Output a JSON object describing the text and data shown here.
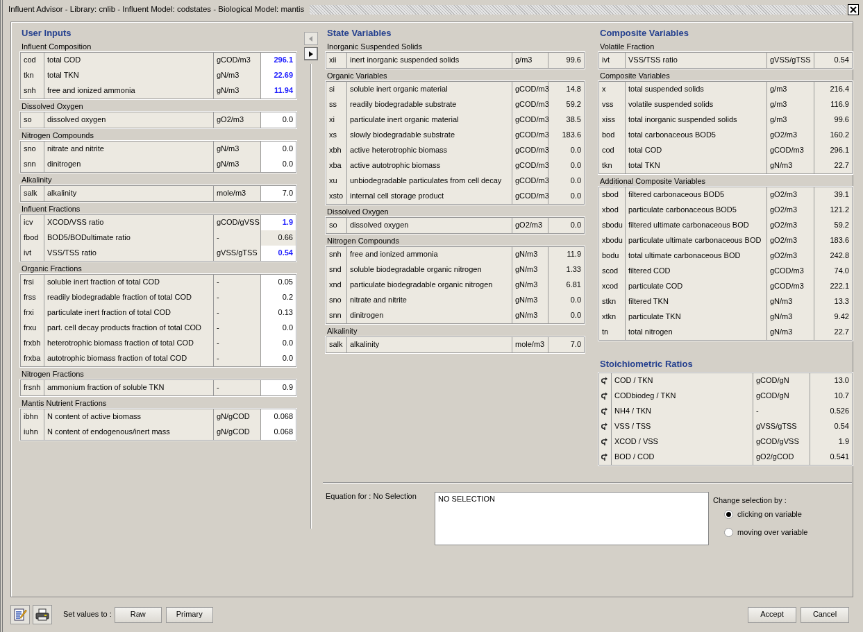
{
  "window": {
    "title": "Influent Advisor - Library: cnlib - Influent Model: codstates - Biological Model: mantis"
  },
  "user_inputs": {
    "title": "User Inputs",
    "groups": [
      {
        "label": "Influent Composition",
        "rows": [
          {
            "symbol": "cod",
            "description": "total COD",
            "unit": "gCOD/m3",
            "value": "296.1",
            "editable": true,
            "modified": true
          },
          {
            "symbol": "tkn",
            "description": "total TKN",
            "unit": "gN/m3",
            "value": "22.69",
            "editable": true,
            "modified": true
          },
          {
            "symbol": "snh",
            "description": "free and ionized ammonia",
            "unit": "gN/m3",
            "value": "11.94",
            "editable": true,
            "modified": true
          }
        ]
      },
      {
        "label": "Dissolved Oxygen",
        "rows": [
          {
            "symbol": "so",
            "description": "dissolved oxygen",
            "unit": "gO2/m3",
            "value": "0.0",
            "editable": true,
            "modified": false
          }
        ]
      },
      {
        "label": "Nitrogen Compounds",
        "rows": [
          {
            "symbol": "sno",
            "description": "nitrate and nitrite",
            "unit": "gN/m3",
            "value": "0.0",
            "editable": true,
            "modified": false
          },
          {
            "symbol": "snn",
            "description": "dinitrogen",
            "unit": "gN/m3",
            "value": "0.0",
            "editable": true,
            "modified": false
          }
        ]
      },
      {
        "label": "Alkalinity",
        "rows": [
          {
            "symbol": "salk",
            "description": "alkalinity",
            "unit": "mole/m3",
            "value": "7.0",
            "editable": true,
            "modified": false
          }
        ]
      },
      {
        "label": "Influent Fractions",
        "rows": [
          {
            "symbol": "icv",
            "description": "XCOD/VSS ratio",
            "unit": "gCOD/gVSS",
            "value": "1.9",
            "editable": true,
            "modified": true
          },
          {
            "symbol": "fbod",
            "description": "BOD5/BODultimate ratio",
            "unit": "-",
            "value": "0.66",
            "editable": false,
            "modified": false
          },
          {
            "symbol": "ivt",
            "description": "VSS/TSS ratio",
            "unit": "gVSS/gTSS",
            "value": "0.54",
            "editable": true,
            "modified": true
          }
        ]
      },
      {
        "label": "Organic Fractions",
        "rows": [
          {
            "symbol": "frsi",
            "description": "soluble inert fraction of total COD",
            "unit": "-",
            "value": "0.05",
            "editable": true,
            "modified": false
          },
          {
            "symbol": "frss",
            "description": "readily biodegradable fraction of total COD",
            "unit": "-",
            "value": "0.2",
            "editable": true,
            "modified": false
          },
          {
            "symbol": "frxi",
            "description": "particulate inert fraction of total COD",
            "unit": "-",
            "value": "0.13",
            "editable": true,
            "modified": false
          },
          {
            "symbol": "frxu",
            "description": "part. cell decay products fraction of total COD",
            "unit": "-",
            "value": "0.0",
            "editable": true,
            "modified": false
          },
          {
            "symbol": "frxbh",
            "description": "heterotrophic biomass fraction of total COD",
            "unit": "-",
            "value": "0.0",
            "editable": true,
            "modified": false
          },
          {
            "symbol": "frxba",
            "description": "autotrophic biomass fraction of total COD",
            "unit": "-",
            "value": "0.0",
            "editable": true,
            "modified": false
          }
        ]
      },
      {
        "label": "Nitrogen Fractions",
        "rows": [
          {
            "symbol": "frsnh",
            "description": "ammonium fraction of soluble TKN",
            "unit": "-",
            "value": "0.9",
            "editable": true,
            "modified": false
          }
        ]
      },
      {
        "label": "Mantis Nutrient Fractions",
        "rows": [
          {
            "symbol": "ibhn",
            "description": "N content of active biomass",
            "unit": "gN/gCOD",
            "value": "0.068",
            "editable": true,
            "modified": false
          },
          {
            "symbol": "iuhn",
            "description": "N content of endogenous/inert mass",
            "unit": "gN/gCOD",
            "value": "0.068",
            "editable": true,
            "modified": false
          }
        ]
      }
    ]
  },
  "state_variables": {
    "title": "State Variables",
    "groups": [
      {
        "label": "Inorganic Suspended Solids",
        "rows": [
          {
            "symbol": "xii",
            "description": "inert inorganic suspended solids",
            "unit": "g/m3",
            "value": "99.6"
          }
        ]
      },
      {
        "label": "Organic Variables",
        "rows": [
          {
            "symbol": "si",
            "description": "soluble inert organic material",
            "unit": "gCOD/m3",
            "value": "14.8"
          },
          {
            "symbol": "ss",
            "description": "readily biodegradable substrate",
            "unit": "gCOD/m3",
            "value": "59.2"
          },
          {
            "symbol": "xi",
            "description": "particulate inert organic material",
            "unit": "gCOD/m3",
            "value": "38.5"
          },
          {
            "symbol": "xs",
            "description": "slowly biodegradable substrate",
            "unit": "gCOD/m3",
            "value": "183.6"
          },
          {
            "symbol": "xbh",
            "description": "active heterotrophic biomass",
            "unit": "gCOD/m3",
            "value": "0.0"
          },
          {
            "symbol": "xba",
            "description": "active autotrophic biomass",
            "unit": "gCOD/m3",
            "value": "0.0"
          },
          {
            "symbol": "xu",
            "description": "unbiodegradable particulates from cell decay",
            "unit": "gCOD/m3",
            "value": "0.0"
          },
          {
            "symbol": "xsto",
            "description": "internal cell storage product",
            "unit": "gCOD/m3",
            "value": "0.0"
          }
        ]
      },
      {
        "label": "Dissolved Oxygen",
        "rows": [
          {
            "symbol": "so",
            "description": "dissolved oxygen",
            "unit": "gO2/m3",
            "value": "0.0"
          }
        ]
      },
      {
        "label": "Nitrogen Compounds",
        "rows": [
          {
            "symbol": "snh",
            "description": "free and ionized ammonia",
            "unit": "gN/m3",
            "value": "11.9"
          },
          {
            "symbol": "snd",
            "description": "soluble biodegradable organic nitrogen",
            "unit": "gN/m3",
            "value": "1.33"
          },
          {
            "symbol": "xnd",
            "description": "particulate biodegradable organic nitrogen",
            "unit": "gN/m3",
            "value": "6.81"
          },
          {
            "symbol": "sno",
            "description": "nitrate and nitrite",
            "unit": "gN/m3",
            "value": "0.0"
          },
          {
            "symbol": "snn",
            "description": "dinitrogen",
            "unit": "gN/m3",
            "value": "0.0"
          }
        ]
      },
      {
        "label": "Alkalinity",
        "rows": [
          {
            "symbol": "salk",
            "description": "alkalinity",
            "unit": "mole/m3",
            "value": "7.0"
          }
        ]
      }
    ]
  },
  "composite_variables": {
    "title": "Composite Variables",
    "groups": [
      {
        "label": "Volatile Fraction",
        "rows": [
          {
            "symbol": "ivt",
            "description": "VSS/TSS ratio",
            "unit": "gVSS/gTSS",
            "value": "0.54"
          }
        ]
      },
      {
        "label": "Composite Variables",
        "rows": [
          {
            "symbol": "x",
            "description": "total suspended solids",
            "unit": "g/m3",
            "value": "216.4"
          },
          {
            "symbol": "vss",
            "description": "volatile suspended solids",
            "unit": "g/m3",
            "value": "116.9"
          },
          {
            "symbol": "xiss",
            "description": "total inorganic suspended solids",
            "unit": "g/m3",
            "value": "99.6"
          },
          {
            "symbol": "bod",
            "description": "total carbonaceous BOD5",
            "unit": "gO2/m3",
            "value": "160.2"
          },
          {
            "symbol": "cod",
            "description": "total COD",
            "unit": "gCOD/m3",
            "value": "296.1"
          },
          {
            "symbol": "tkn",
            "description": "total TKN",
            "unit": "gN/m3",
            "value": "22.7"
          }
        ]
      },
      {
        "label": "Additional Composite Variables",
        "rows": [
          {
            "symbol": "sbod",
            "description": "filtered carbonaceous BOD5",
            "unit": "gO2/m3",
            "value": "39.1"
          },
          {
            "symbol": "xbod",
            "description": "particulate carbonaceous BOD5",
            "unit": "gO2/m3",
            "value": "121.2"
          },
          {
            "symbol": "sbodu",
            "description": "filtered ultimate carbonaceous BOD",
            "unit": "gO2/m3",
            "value": "59.2"
          },
          {
            "symbol": "xbodu",
            "description": "particulate ultimate carbonaceous BOD",
            "unit": "gO2/m3",
            "value": "183.6"
          },
          {
            "symbol": "bodu",
            "description": "total ultimate carbonaceous BOD",
            "unit": "gO2/m3",
            "value": "242.8"
          },
          {
            "symbol": "scod",
            "description": "filtered COD",
            "unit": "gCOD/m3",
            "value": "74.0"
          },
          {
            "symbol": "xcod",
            "description": "particulate COD",
            "unit": "gCOD/m3",
            "value": "222.1"
          },
          {
            "symbol": "stkn",
            "description": "filtered TKN",
            "unit": "gN/m3",
            "value": "13.3"
          },
          {
            "symbol": "xtkn",
            "description": "particulate TKN",
            "unit": "gN/m3",
            "value": "9.42"
          },
          {
            "symbol": "tn",
            "description": "total nitrogen",
            "unit": "gN/m3",
            "value": "22.7"
          }
        ]
      }
    ]
  },
  "stoichiometric_ratios": {
    "title": "Stoichiometric Ratios",
    "rows": [
      {
        "name": "COD / TKN",
        "unit": "gCOD/gN",
        "value": "13.0"
      },
      {
        "name": "CODbiodeg / TKN",
        "unit": "gCOD/gN",
        "value": "10.7"
      },
      {
        "name": "NH4 / TKN",
        "unit": "-",
        "value": "0.526"
      },
      {
        "name": "VSS / TSS",
        "unit": "gVSS/gTSS",
        "value": "0.54"
      },
      {
        "name": "XCOD / VSS",
        "unit": "gCOD/gVSS",
        "value": "1.9"
      },
      {
        "name": "BOD / COD",
        "unit": "gO2/gCOD",
        "value": "0.541"
      }
    ]
  },
  "equation": {
    "label": "Equation for : No Selection",
    "text": "NO SELECTION"
  },
  "selection_mode": {
    "label": "Change selection by :",
    "options": [
      {
        "label": "clicking on variable",
        "selected": true
      },
      {
        "label": "moving over variable",
        "selected": false
      }
    ]
  },
  "toolbar": {
    "set_values_label": "Set values to :",
    "buttons": [
      "Raw",
      "Primary"
    ]
  },
  "dialog_buttons": [
    "Accept",
    "Cancel"
  ]
}
